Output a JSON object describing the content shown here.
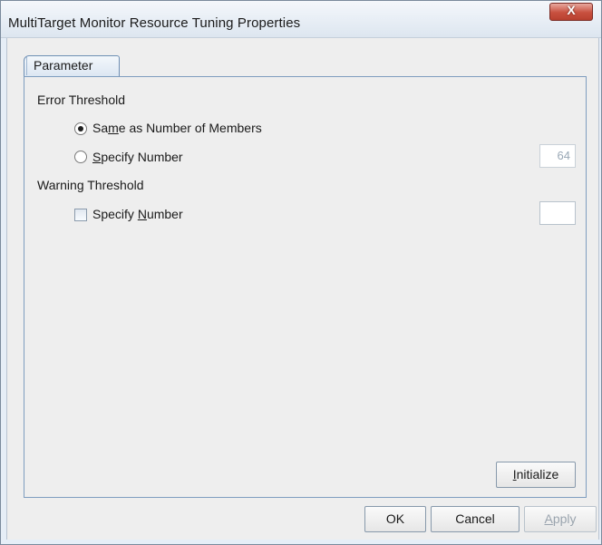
{
  "window": {
    "title": "MultiTarget Monitor Resource Tuning Properties",
    "close_glyph": "X"
  },
  "tabs": [
    {
      "label": "Parameter",
      "selected": true
    }
  ],
  "error_threshold": {
    "heading": "Error Threshold",
    "same_as_members": {
      "pre": "Sa",
      "mnemonic": "m",
      "post": "e as Number of Members",
      "checked": true
    },
    "specify_number": {
      "pre": "",
      "mnemonic": "S",
      "post": "pecify Number",
      "checked": false
    },
    "value": "64",
    "value_enabled": false
  },
  "warning_threshold": {
    "heading": "Warning Threshold",
    "specify_number": {
      "pre": "Specify ",
      "mnemonic": "N",
      "post": "umber",
      "checked": false
    },
    "value": ""
  },
  "buttons": {
    "initialize": {
      "pre": "",
      "mnemonic": "I",
      "post": "nitialize"
    },
    "ok": "OK",
    "cancel": "Cancel",
    "apply": {
      "pre": "",
      "mnemonic": "A",
      "post": "pply",
      "enabled": false
    }
  },
  "colors": {
    "accent": "#6e8fb4",
    "close_button": "#c8503f"
  }
}
